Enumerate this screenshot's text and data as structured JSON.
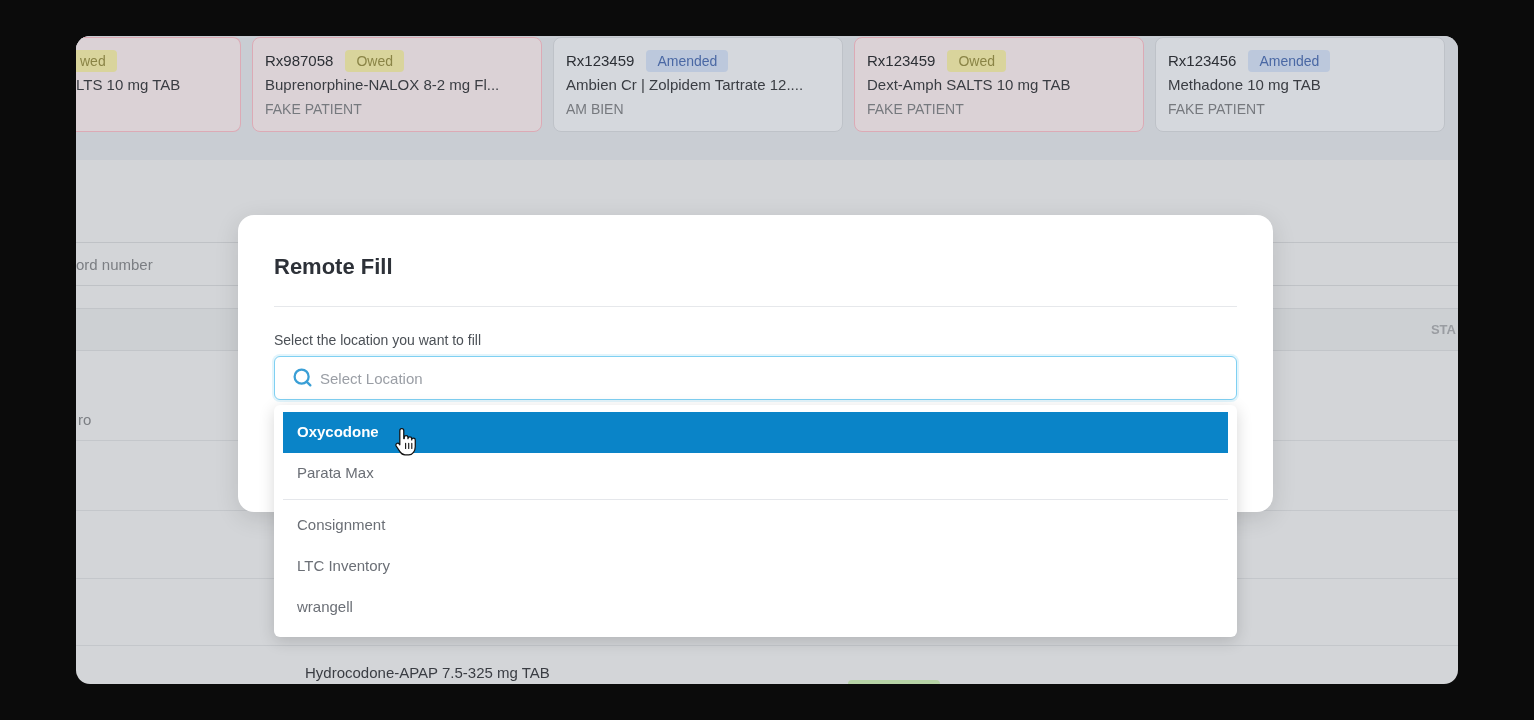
{
  "cards": [
    {
      "cut_left": true,
      "kind": "owed",
      "badge": "wed",
      "drug": "LTS 10 mg TAB"
    },
    {
      "cut_left": false,
      "rx": "Rx987058",
      "kind": "owed",
      "badge": "Owed",
      "drug": "Buprenorphine-NALOX 8-2 mg Fl...",
      "patient": "FAKE PATIENT"
    },
    {
      "cut_left": false,
      "rx": "Rx123459",
      "kind": "amended",
      "badge": "Amended",
      "drug": "Ambien Cr | Zolpidem Tartrate 12....",
      "patient": "AM BIEN"
    },
    {
      "cut_left": false,
      "rx": "Rx123459",
      "kind": "owed",
      "badge": "Owed",
      "drug": "Dext-Amph SALTS 10 mg TAB",
      "patient": "FAKE PATIENT"
    },
    {
      "cut_left": false,
      "rx": "Rx123456",
      "kind": "amended",
      "badge": "Amended",
      "drug": "Methadone 10 mg TAB",
      "patient": "FAKE PATIENT"
    }
  ],
  "search": {
    "placeholder": "ord number"
  },
  "table": {
    "header": "STA",
    "rows": [
      {
        "column_1": "ro"
      },
      {},
      {},
      {},
      {
        "column_2": "Hydrocodone-APAP 7.5-325 mg TAB",
        "status_tag": true
      }
    ]
  },
  "modal": {
    "title": "Remote Fill",
    "field": {
      "label": "Select the location you want to fill",
      "placeholder": "Select Location",
      "focused": true
    },
    "dropdown": {
      "groups": [
        {
          "items": [
            {
              "label": "Oxycodone",
              "selected": true
            },
            {
              "label": "Parata Max",
              "selected": false
            }
          ]
        },
        {
          "items": [
            {
              "label": "Consignment",
              "selected": false
            },
            {
              "label": "LTC Inventory",
              "selected": false
            },
            {
              "label": "wrangell",
              "selected": false
            }
          ]
        }
      ]
    }
  }
}
